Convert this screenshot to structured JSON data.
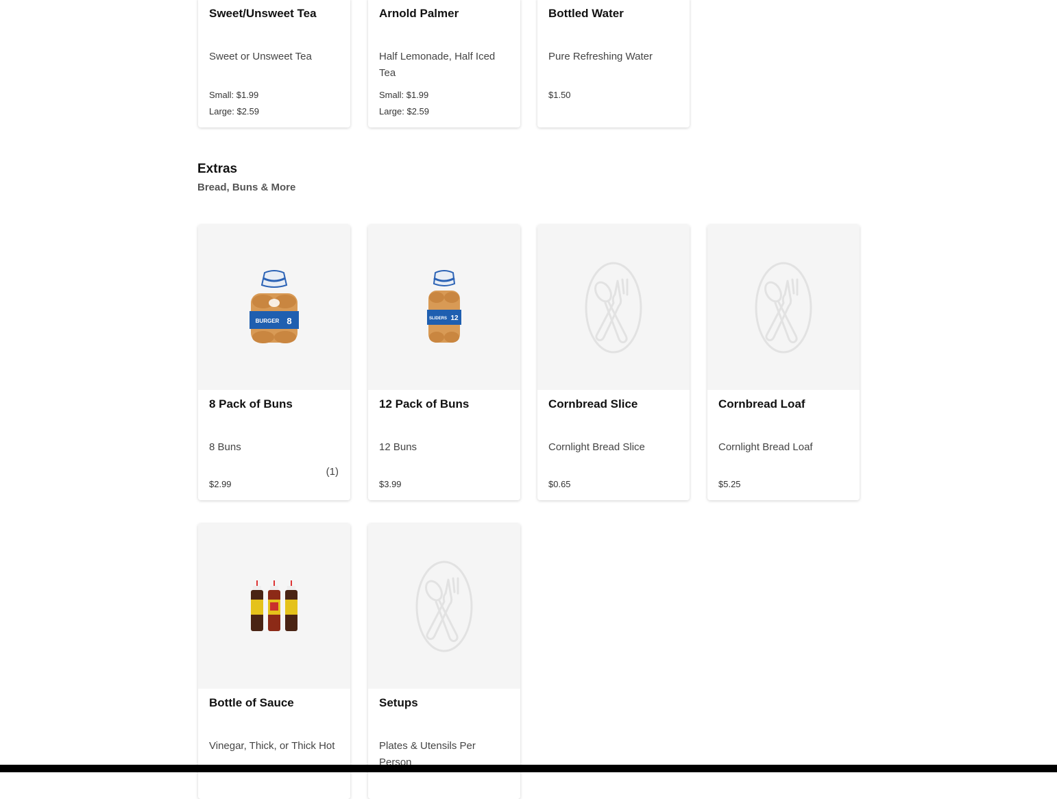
{
  "drinks": [
    {
      "name": "Sweet/Unsweet Tea",
      "description": "Sweet or Unsweet Tea",
      "prices": [
        "Small: $1.99",
        "Large: $2.59"
      ]
    },
    {
      "name": "Arnold Palmer",
      "description": "Half Lemonade, Half Iced Tea",
      "prices": [
        "Small: $1.99",
        "Large: $2.59"
      ]
    },
    {
      "name": "Bottled Water",
      "description": "Pure Refreshing Water",
      "prices": [
        "$1.50"
      ]
    }
  ],
  "extras": {
    "title": "Extras",
    "subtitle": "Bread, Buns & More",
    "items": [
      {
        "name": "8 Pack of Buns",
        "description": "8 Buns",
        "price": "$2.99",
        "count": "(1)",
        "image": "buns-8-pack-photo"
      },
      {
        "name": "12 Pack of Buns",
        "description": "12 Buns",
        "price": "$3.99",
        "image": "buns-12-pack-photo"
      },
      {
        "name": "Cornbread Slice",
        "description": "Cornlight Bread Slice",
        "price": "$0.65",
        "image": "plate-utensils-placeholder-icon"
      },
      {
        "name": "Cornbread Loaf",
        "description": "Cornlight Bread Loaf",
        "price": "$5.25",
        "image": "plate-utensils-placeholder-icon"
      },
      {
        "name": "Bottle of Sauce",
        "description": "Vinegar, Thick, or Thick Hot",
        "image": "sauce-bottles-photo"
      },
      {
        "name": "Setups",
        "description": "Plates & Utensils Per Person",
        "image": "plate-utensils-placeholder-icon"
      }
    ]
  },
  "colors": {
    "card_image_bg": "#f5f5f5",
    "bun_bag_blue": "#1f5fb0",
    "bun_color": "#d89a55"
  },
  "image_labels": {
    "bun8_band": "BURGER",
    "bun8_number": "8",
    "bun12_band": "SLIDERS",
    "bun12_number": "12"
  }
}
